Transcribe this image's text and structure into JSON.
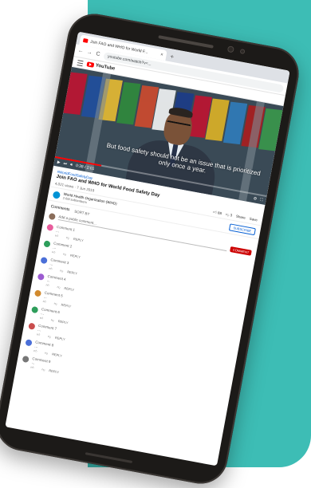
{
  "browser": {
    "tab_title": "Join FAO and WHO for World F...",
    "tab_close": "×",
    "new_tab": "+",
    "nav_back": "←",
    "nav_forward": "→",
    "nav_reload": "C",
    "url": "youtube.com/watch?v=..."
  },
  "youtube": {
    "logo_text": "YouTube"
  },
  "video": {
    "caption": "But food safety should not be an issue that is prioritized only once a year.",
    "progress_percent": 22,
    "time": "0:38 / 2:01"
  },
  "info": {
    "hashtag": "#WorldFoodSafetyDay",
    "title": "Join FAO and WHO for World Food Safety Day",
    "views": "4,021 views · 7 Jun 2019",
    "likes": "88",
    "dislikes": "3",
    "share": "Share",
    "save": "Save"
  },
  "channel": {
    "name": "World Health Organization (WHO)",
    "subs": "2.6M subscribers",
    "subscribe": "SUBSCRIBE"
  },
  "comments": {
    "heading": "Comments",
    "sort": "SORT BY",
    "placeholder": "Add a public comment...",
    "send": "COMMENT",
    "items": [
      {
        "author": "Comment 1",
        "time": "",
        "text": "…",
        "color": "#e85d9c",
        "likes": "",
        "reply": "REPLY"
      },
      {
        "author": "Comment 2",
        "time": "",
        "text": "…",
        "color": "#2e9e5b",
        "likes": "",
        "reply": "REPLY"
      },
      {
        "author": "Comment 3",
        "time": "",
        "text": "…",
        "color": "#4a6fd8",
        "likes": "",
        "reply": "REPLY"
      },
      {
        "author": "Comment 4",
        "time": "",
        "text": "…",
        "color": "#9c5bd1",
        "likes": "",
        "reply": "REPLY"
      },
      {
        "author": "Comment 5",
        "time": "",
        "text": "…",
        "color": "#d18a2e",
        "likes": "",
        "reply": "REPLY"
      },
      {
        "author": "Comment 6",
        "time": "",
        "text": "…",
        "color": "#2e9e5b",
        "likes": "",
        "reply": "REPLY"
      },
      {
        "author": "Comment 7",
        "time": "",
        "text": "…",
        "color": "#c94d4d",
        "likes": "",
        "reply": "REPLY"
      },
      {
        "author": "Comment 8",
        "time": "",
        "text": "…",
        "color": "#4a6fd8",
        "likes": "",
        "reply": "REPLY"
      },
      {
        "author": "Comment 9",
        "time": "",
        "text": "…",
        "color": "#777777",
        "likes": "",
        "reply": "REPLY"
      }
    ]
  },
  "colors": {
    "background_card": "#3dbdb5",
    "phone_body": "#1c1a18",
    "youtube_red": "#ff0000",
    "link_blue": "#065fd4"
  }
}
